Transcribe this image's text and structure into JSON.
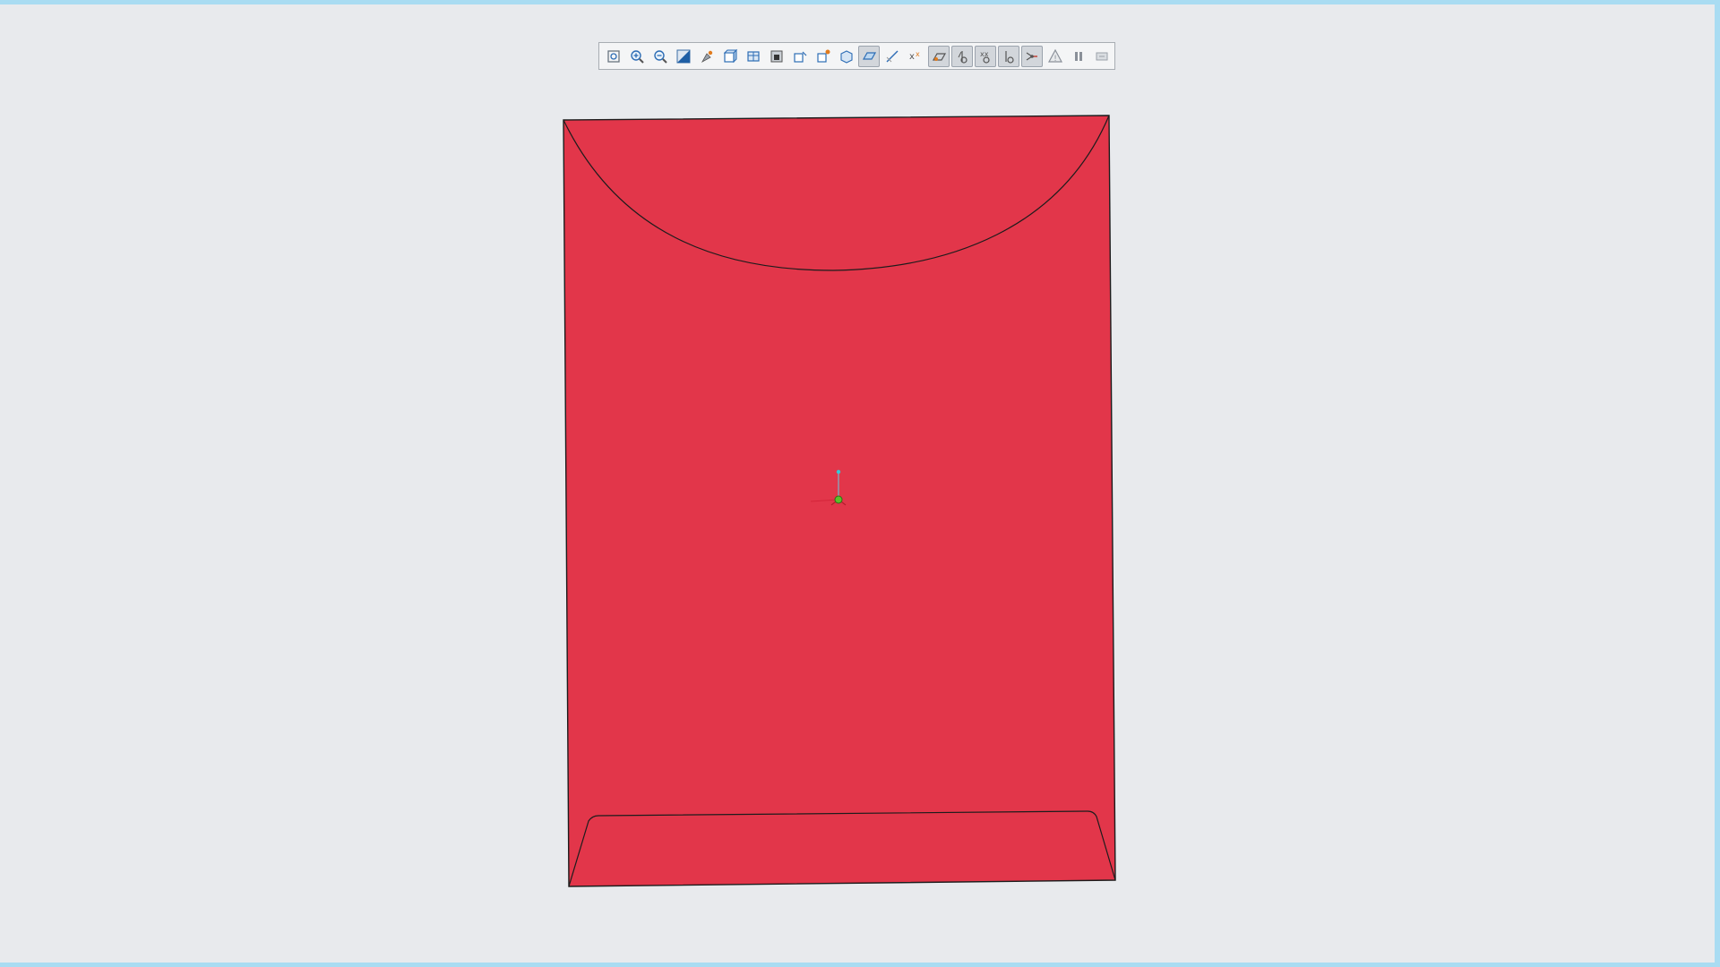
{
  "window": {
    "frame_color": "#a9dcf2",
    "background_color": "#e8eaed"
  },
  "toolbar": {
    "buttons": [
      {
        "icon": "refit-icon",
        "active": false
      },
      {
        "icon": "zoom-in-icon",
        "active": false
      },
      {
        "icon": "zoom-out-icon",
        "active": false
      },
      {
        "icon": "repaint-icon",
        "active": false
      },
      {
        "icon": "orient-icon",
        "active": false
      },
      {
        "icon": "saved-views-icon",
        "active": false
      },
      {
        "icon": "view-manager-icon",
        "active": false
      },
      {
        "icon": "appearance-icon",
        "active": false
      },
      {
        "icon": "spin-center-icon",
        "active": false
      },
      {
        "icon": "display-style-icon",
        "active": false
      },
      {
        "icon": "perspective-icon",
        "active": false
      },
      {
        "icon": "plane-display-icon",
        "active": true
      },
      {
        "icon": "axis-display-icon",
        "active": false
      },
      {
        "icon": "point-display-icon",
        "active": false
      },
      {
        "icon": "csys-display-icon",
        "active": true
      },
      {
        "icon": "annotation-display-icon",
        "active": true
      },
      {
        "icon": "point-tag-icon",
        "active": true
      },
      {
        "icon": "csys-tag-icon",
        "active": true
      },
      {
        "icon": "spin-center-display-icon",
        "active": true
      },
      {
        "icon": "warning-icon",
        "active": false
      },
      {
        "icon": "pause-icon",
        "active": false
      },
      {
        "icon": "view-flyout-icon",
        "active": false
      }
    ]
  },
  "model": {
    "fill_color": "#e2364a",
    "edge_color": "#1c1c1c"
  }
}
